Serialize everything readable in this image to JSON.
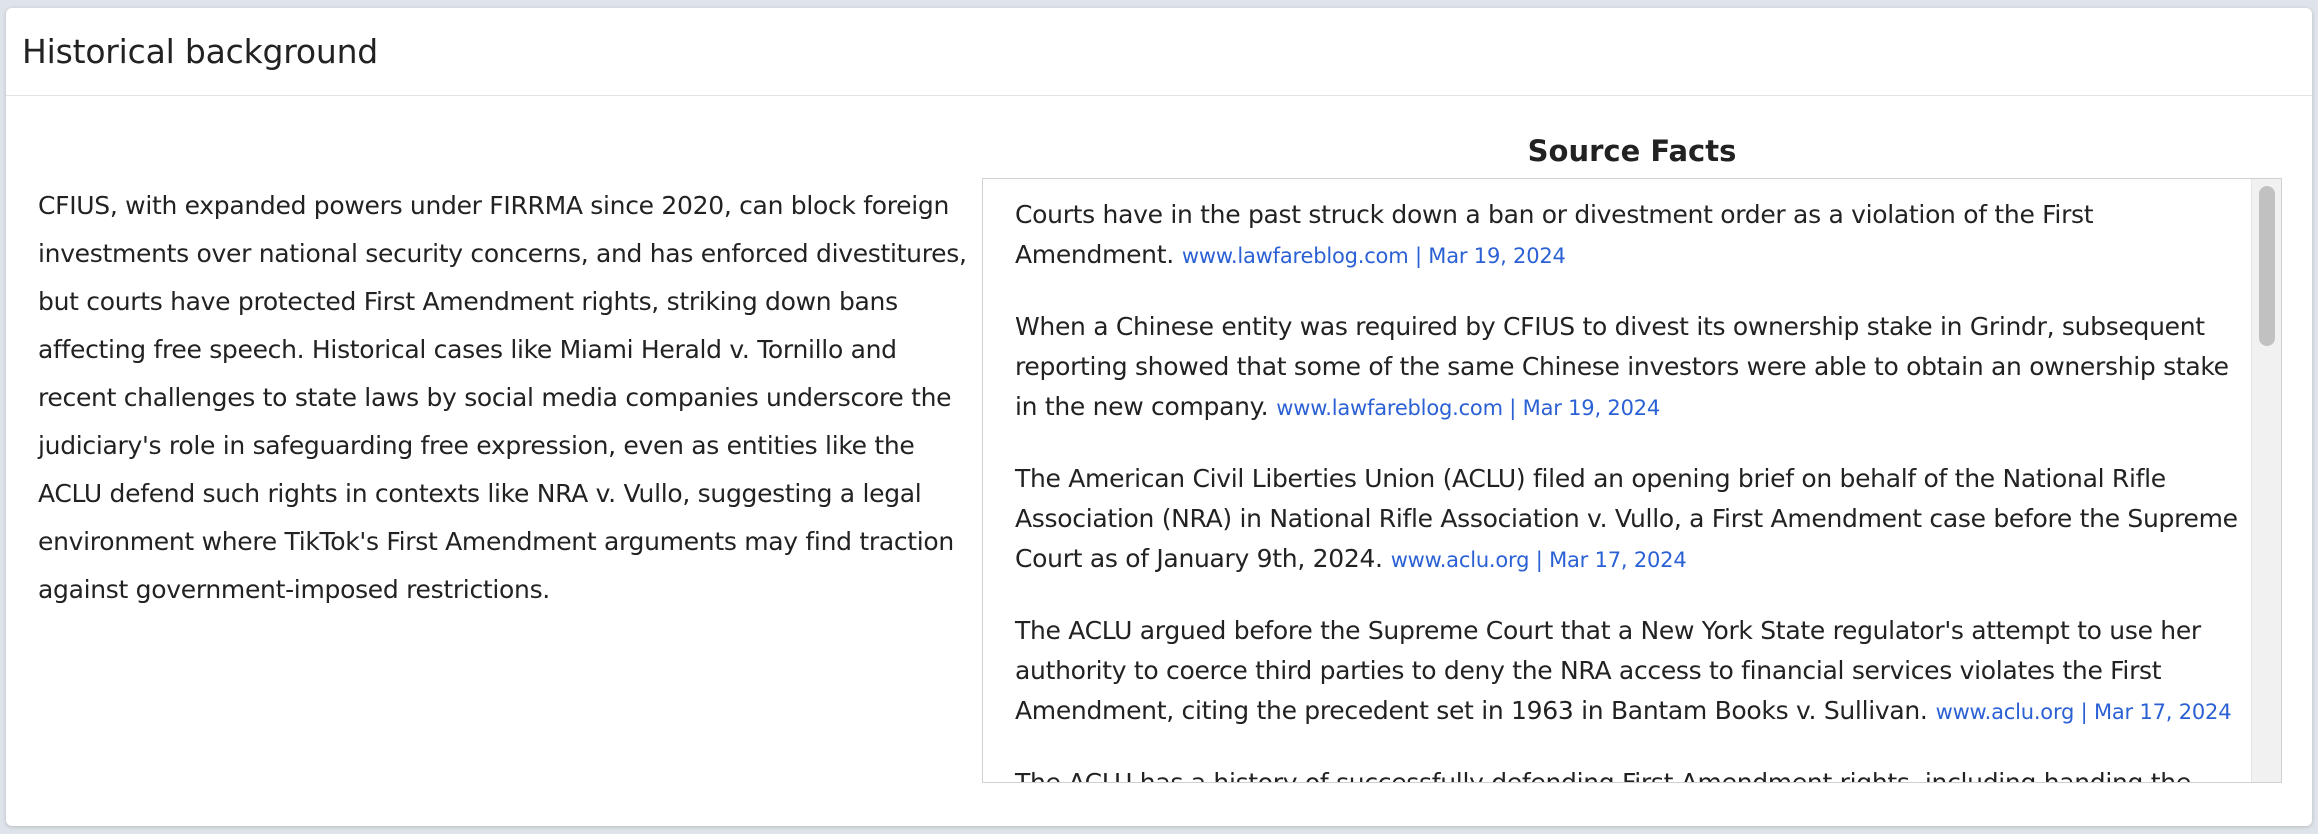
{
  "panel": {
    "title": "Historical background"
  },
  "summary": {
    "text": "CFIUS, with expanded powers under FIRRMA since 2020, can block foreign investments over national security concerns, and has enforced divestitures, but courts have protected First Amendment rights, striking down bans affecting free speech. Historical cases like Miami Herald v. Tornillo and recent challenges to state laws by social media companies underscore the judiciary's role in safeguarding free expression, even as entities like the ACLU defend such rights in contexts like NRA v. Vullo, suggesting a legal environment where TikTok's First Amendment arguments may find traction against government-imposed restrictions."
  },
  "source_facts": {
    "heading": "Source Facts",
    "items": [
      {
        "text": "Courts have in the past struck down a ban or divestment order as a violation of the First Amendment.",
        "source": "www.lawfareblog.com | Mar 19, 2024"
      },
      {
        "text": "When a Chinese entity was required by CFIUS to divest its ownership stake in Grindr, subsequent reporting showed that some of the same Chinese investors were able to obtain an ownership stake in the new company.",
        "source": "www.lawfareblog.com | Mar 19, 2024"
      },
      {
        "text": "The American Civil Liberties Union (ACLU) filed an opening brief on behalf of the National Rifle Association (NRA) in National Rifle Association v. Vullo, a First Amendment case before the Supreme Court as of January 9th, 2024.",
        "source": "www.aclu.org | Mar 17, 2024"
      },
      {
        "text": "The ACLU argued before the Supreme Court that a New York State regulator's attempt to use her authority to coerce third parties to deny the NRA access to financial services violates the First Amendment, citing the precedent set in 1963 in Bantam Books v. Sullivan.",
        "source": "www.aclu.org | Mar 17, 2024"
      },
      {
        "text": "The ACLU has a history of successfully defending First Amendment rights, including handing the",
        "source": ""
      }
    ]
  }
}
